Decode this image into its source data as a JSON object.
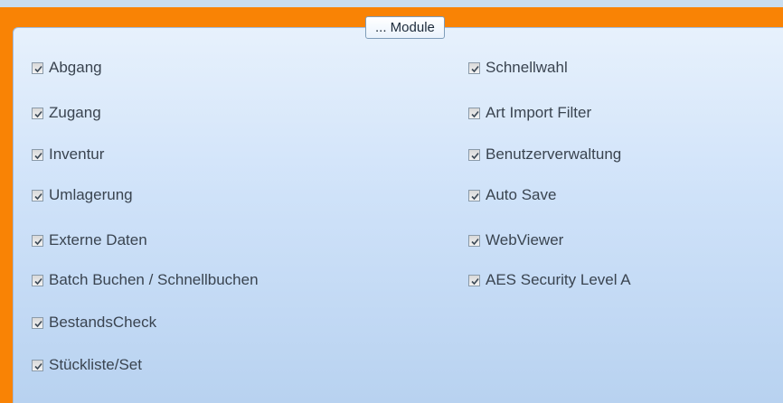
{
  "group": {
    "title": "... Module"
  },
  "left_column": [
    {
      "label": "Abgang",
      "checked": true
    },
    {
      "label": "Zugang",
      "checked": true
    },
    {
      "label": "Inventur",
      "checked": true
    },
    {
      "label": "Umlagerung",
      "checked": true
    },
    {
      "label": "Externe Daten",
      "checked": true
    },
    {
      "label": "Batch Buchen / Schnellbuchen",
      "checked": true
    },
    {
      "label": "BestandsCheck",
      "checked": true
    },
    {
      "label": "Stückliste/Set",
      "checked": true
    }
  ],
  "right_column": [
    {
      "label": "Schnellwahl",
      "checked": true
    },
    {
      "label": "Art Import Filter",
      "checked": true
    },
    {
      "label": "Benutzerverwaltung",
      "checked": true
    },
    {
      "label": "Auto Save",
      "checked": true
    },
    {
      "label": "WebViewer",
      "checked": true
    },
    {
      "label": "AES Security Level A",
      "checked": true
    }
  ],
  "colors": {
    "accent_border": "#f98305",
    "panel_top": "#e7f1fc",
    "panel_bottom": "#b8d2f0"
  },
  "icons": {
    "check": "checkmark-icon"
  }
}
